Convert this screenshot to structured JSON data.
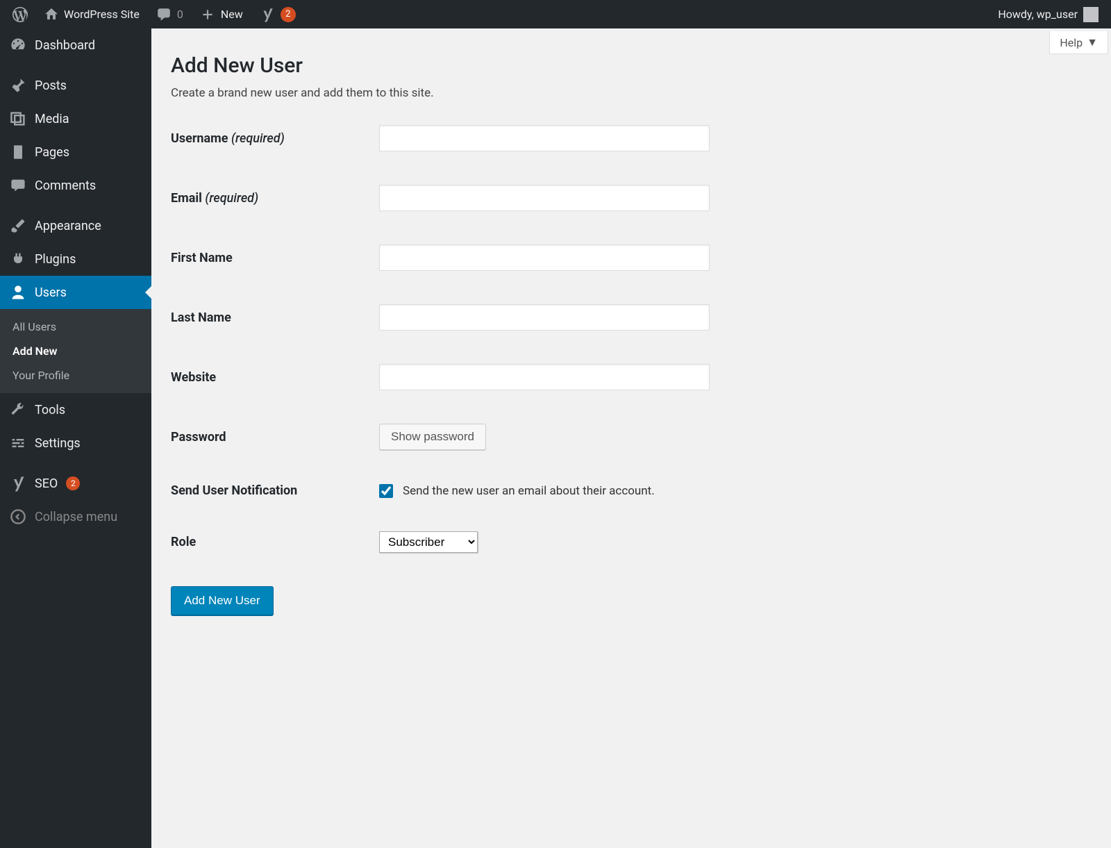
{
  "adminbar": {
    "site_name": "WordPress Site",
    "comments_count": "0",
    "new_label": "New",
    "yoast_count": "2",
    "howdy": "Howdy, wp_user"
  },
  "sidebar": {
    "items": [
      {
        "label": "Dashboard"
      },
      {
        "label": "Posts"
      },
      {
        "label": "Media"
      },
      {
        "label": "Pages"
      },
      {
        "label": "Comments"
      },
      {
        "label": "Appearance"
      },
      {
        "label": "Plugins"
      },
      {
        "label": "Users"
      },
      {
        "label": "Tools"
      },
      {
        "label": "Settings"
      },
      {
        "label": "SEO",
        "count": "2"
      },
      {
        "label": "Collapse menu"
      }
    ],
    "submenu": [
      {
        "label": "All Users"
      },
      {
        "label": "Add New"
      },
      {
        "label": "Your Profile"
      }
    ]
  },
  "help_label": "Help",
  "page": {
    "title": "Add New User",
    "desc": "Create a brand new user and add them to this site.",
    "fields": {
      "username_label": "Username",
      "required": "(required)",
      "email_label": "Email",
      "firstname_label": "First Name",
      "lastname_label": "Last Name",
      "website_label": "Website",
      "password_label": "Password",
      "show_password_btn": "Show password",
      "notif_label": "Send User Notification",
      "notif_text": "Send the new user an email about their account.",
      "notif_checked": true,
      "role_label": "Role",
      "role_value": "Subscriber"
    },
    "submit_label": "Add New User"
  }
}
